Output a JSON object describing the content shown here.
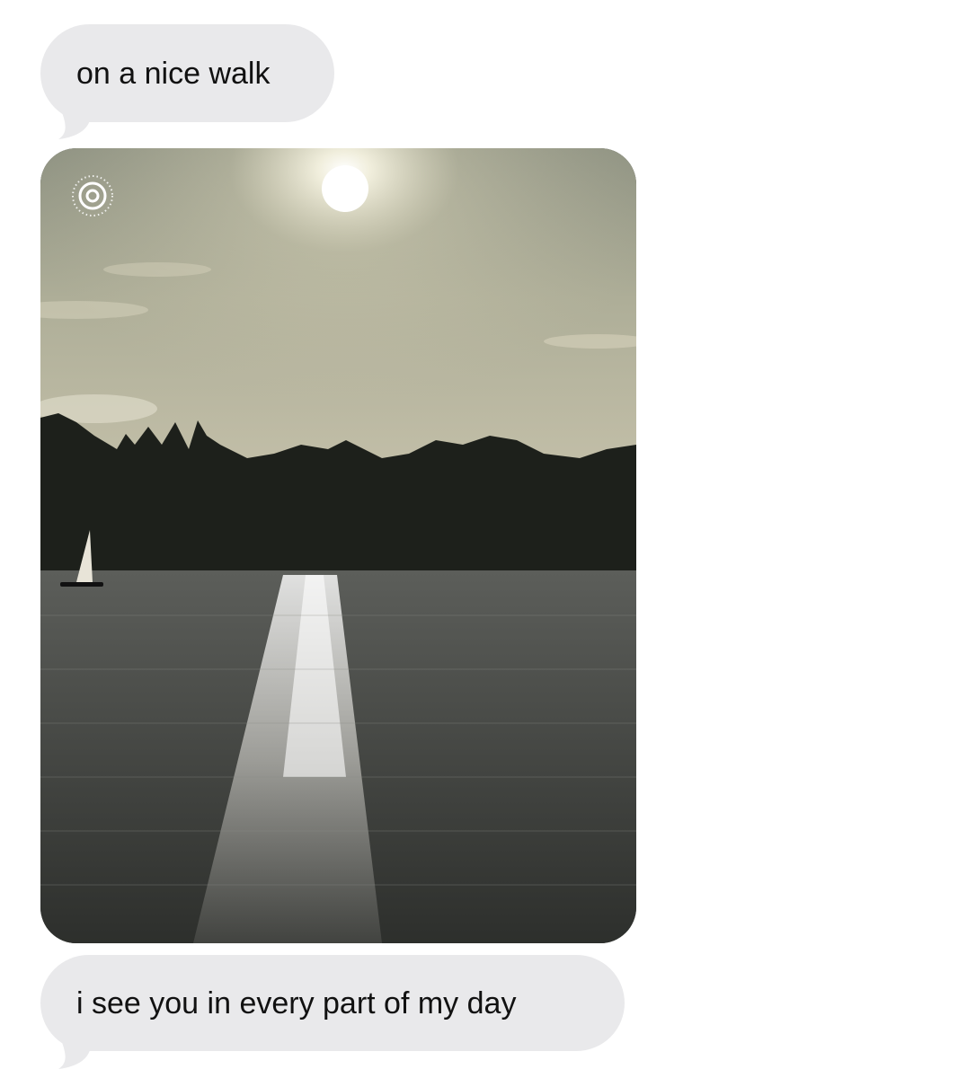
{
  "conversation": {
    "messages": [
      {
        "type": "text",
        "text": "on a nice walk"
      },
      {
        "type": "photo",
        "badge_icon": "live-photo-icon"
      },
      {
        "type": "text",
        "text": "i see you in every part of my day"
      }
    ]
  },
  "colors": {
    "background": "#ffffff",
    "bubble": "#e9e9eb",
    "text": "#111111"
  }
}
